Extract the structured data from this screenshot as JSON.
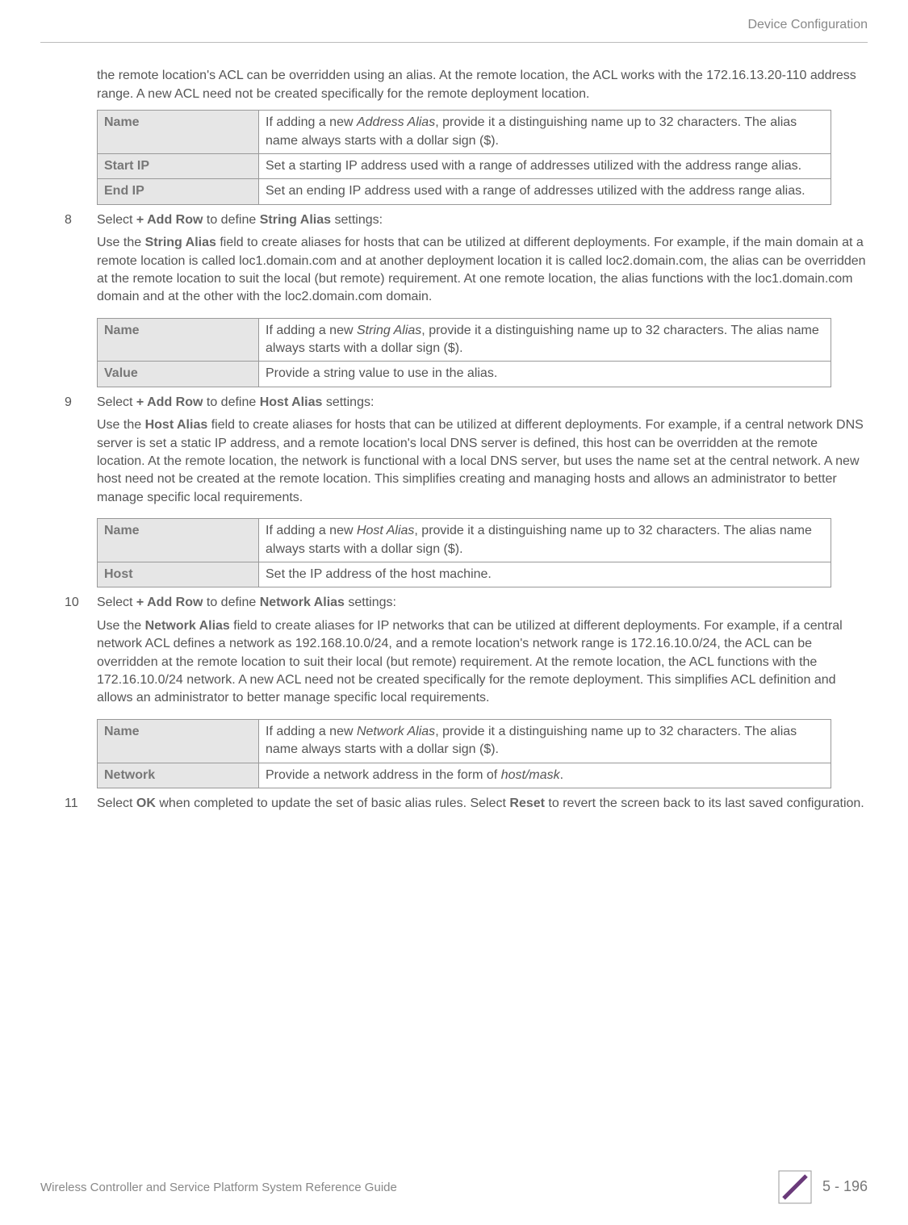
{
  "header": {
    "section": "Device Configuration"
  },
  "intro": "the remote location's ACL can be overridden using an alias. At the remote location, the ACL works with the 172.16.13.20-110 address range. A new ACL need not be created specifically for the remote deployment location.",
  "table1": {
    "r0": {
      "label": "Name",
      "desc_prefix": "If adding a new ",
      "desc_em": "Address Alias",
      "desc_suffix": ", provide it a distinguishing name up to 32 characters. The alias name always starts with a dollar sign ($)."
    },
    "r1": {
      "label": "Start IP",
      "desc": "Set a starting IP address used with a range of addresses utilized with the address range alias."
    },
    "r2": {
      "label": "End IP",
      "desc": "Set an ending IP address used with a range of addresses utilized with the address range alias."
    }
  },
  "step8": {
    "num": "8",
    "line1_pre": "Select ",
    "line1_b1": "+ Add Row",
    "line1_mid": " to define ",
    "line1_b2": "String Alias",
    "line1_post": " settings:",
    "para_pre": "Use the ",
    "para_b": "String Alias",
    "para_post": " field to create aliases for hosts that can be utilized at different deployments. For example, if the main domain at a remote location is called loc1.domain.com and at another deployment location it is called loc2.domain.com, the alias can be overridden at the remote location to suit the local (but remote) requirement. At one remote location, the alias functions with the loc1.domain.com domain and at the other with the loc2.domain.com domain."
  },
  "table2": {
    "r0": {
      "label": "Name",
      "desc_prefix": "If adding a new ",
      "desc_em": "String Alias",
      "desc_suffix": ", provide it a distinguishing name up to 32 characters. The alias name always starts with a dollar sign ($)."
    },
    "r1": {
      "label": "Value",
      "desc": "Provide a string value to use in the alias."
    }
  },
  "step9": {
    "num": "9",
    "line1_pre": "Select ",
    "line1_b1": "+ Add Row",
    "line1_mid": " to define ",
    "line1_b2": "Host Alias",
    "line1_post": " settings:",
    "para_pre": "Use the ",
    "para_b": "Host Alias",
    "para_post": " field to create aliases for hosts that can be utilized at different deployments. For example, if a central network DNS server is set a static IP address, and a remote location's local DNS server is defined, this host can be overridden at the remote location. At the remote location, the network is functional with a local DNS server, but uses the name set at the central network. A new host need not be created at the remote location. This simplifies creating and managing hosts and allows an administrator to better manage specific local requirements."
  },
  "table3": {
    "r0": {
      "label": "Name",
      "desc_prefix": "If adding a new ",
      "desc_em": "Host Alias",
      "desc_suffix": ", provide it a distinguishing name up to 32 characters. The alias name always starts with a dollar sign ($)."
    },
    "r1": {
      "label": "Host",
      "desc": "Set the IP address of the host machine."
    }
  },
  "step10": {
    "num": "10",
    "line1_pre": "Select ",
    "line1_b1": "+ Add Row",
    "line1_mid": " to define ",
    "line1_b2": "Network Alias",
    "line1_post": " settings:",
    "para_pre": "Use the ",
    "para_b": "Network Alias",
    "para_post": " field to create aliases for IP networks that can be utilized at different deployments. For example, if a central network ACL defines a network as 192.168.10.0/24, and a remote location's network range is 172.16.10.0/24, the ACL can be overridden at the remote location to suit their local (but remote) requirement. At the remote location, the ACL functions with the 172.16.10.0/24 network. A new ACL need not be created specifically for the remote deployment. This simplifies ACL definition and allows an administrator to better manage specific local requirements."
  },
  "table4": {
    "r0": {
      "label": "Name",
      "desc_prefix": "If adding a new ",
      "desc_em": "Network Alias",
      "desc_suffix": ", provide it a distinguishing name up to 32 characters. The alias name always starts with a dollar sign ($)."
    },
    "r1": {
      "label": "Network",
      "desc_prefix": "Provide a network address in the form of ",
      "desc_em": "host/mask",
      "desc_suffix": "."
    }
  },
  "step11": {
    "num": "11",
    "pre": "Select ",
    "b1": "OK",
    "mid": " when completed to update the set of basic alias rules. Select ",
    "b2": "Reset",
    "post": " to revert the screen back to its last saved configuration."
  },
  "footer": {
    "left": "Wireless Controller and Service Platform System Reference Guide",
    "page": "5 - 196"
  }
}
